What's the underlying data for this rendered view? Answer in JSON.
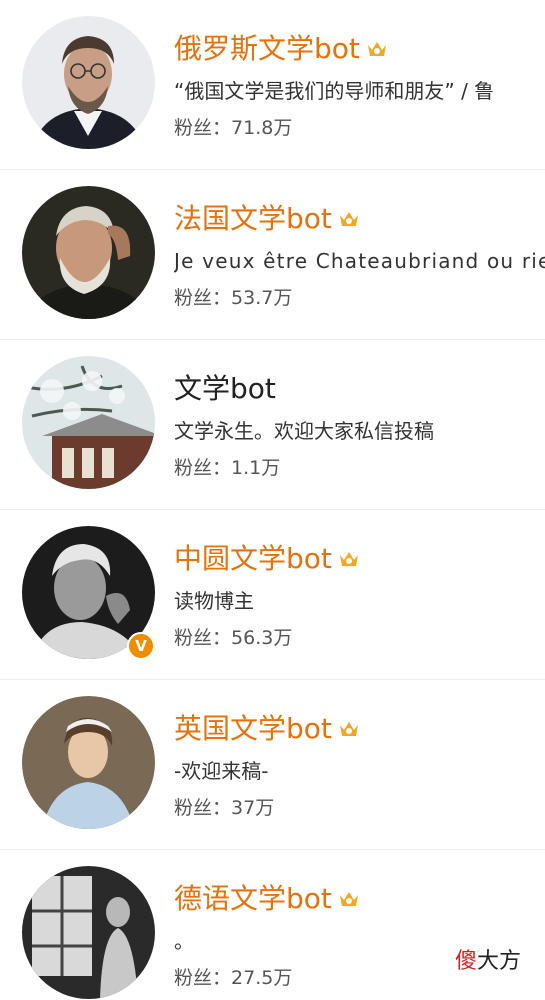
{
  "colors": {
    "vip_name": "#e8710a",
    "normal_name": "#222222",
    "crown": "#f5a623",
    "verified_badge": "#f08c00"
  },
  "accounts": [
    {
      "name": "俄罗斯文学bot",
      "bio": "“俄国文学是我们的导师和朋友” / 鲁",
      "fans_label": "粉丝：",
      "fans_count": "71.8万",
      "vip": true,
      "avatar_icon": "avatar-portrait-chekhov"
    },
    {
      "name": "法国文学bot",
      "bio": "Je veux être Chateaubriand ou rien",
      "fans_label": "粉丝：",
      "fans_count": "53.7万",
      "vip": true,
      "avatar_icon": "avatar-portrait-hugo"
    },
    {
      "name": "文学bot",
      "bio": "文学永生。欢迎大家私信投稿",
      "fans_label": "粉丝：",
      "fans_count": "1.1万",
      "vip": false,
      "avatar_icon": "avatar-snowy-pine-temple"
    },
    {
      "name": "中圆文学bot",
      "bio": "读物博主",
      "fans_label": "粉丝：",
      "fans_count": "56.3万",
      "vip": true,
      "verified": true,
      "verified_mark": "V",
      "avatar_icon": "avatar-portrait-bw"
    },
    {
      "name": "英国文学bot",
      "bio": "-欢迎来稿-",
      "fans_label": "粉丝：",
      "fans_count": "37万",
      "vip": true,
      "avatar_icon": "avatar-portrait-austen"
    },
    {
      "name": "德语文学bot",
      "bio": "。",
      "fans_label": "粉丝：",
      "fans_count": "27.5万",
      "vip": true,
      "avatar_icon": "avatar-statue-window"
    }
  ],
  "watermark": {
    "first_char": "傻",
    "rest": "大方"
  }
}
